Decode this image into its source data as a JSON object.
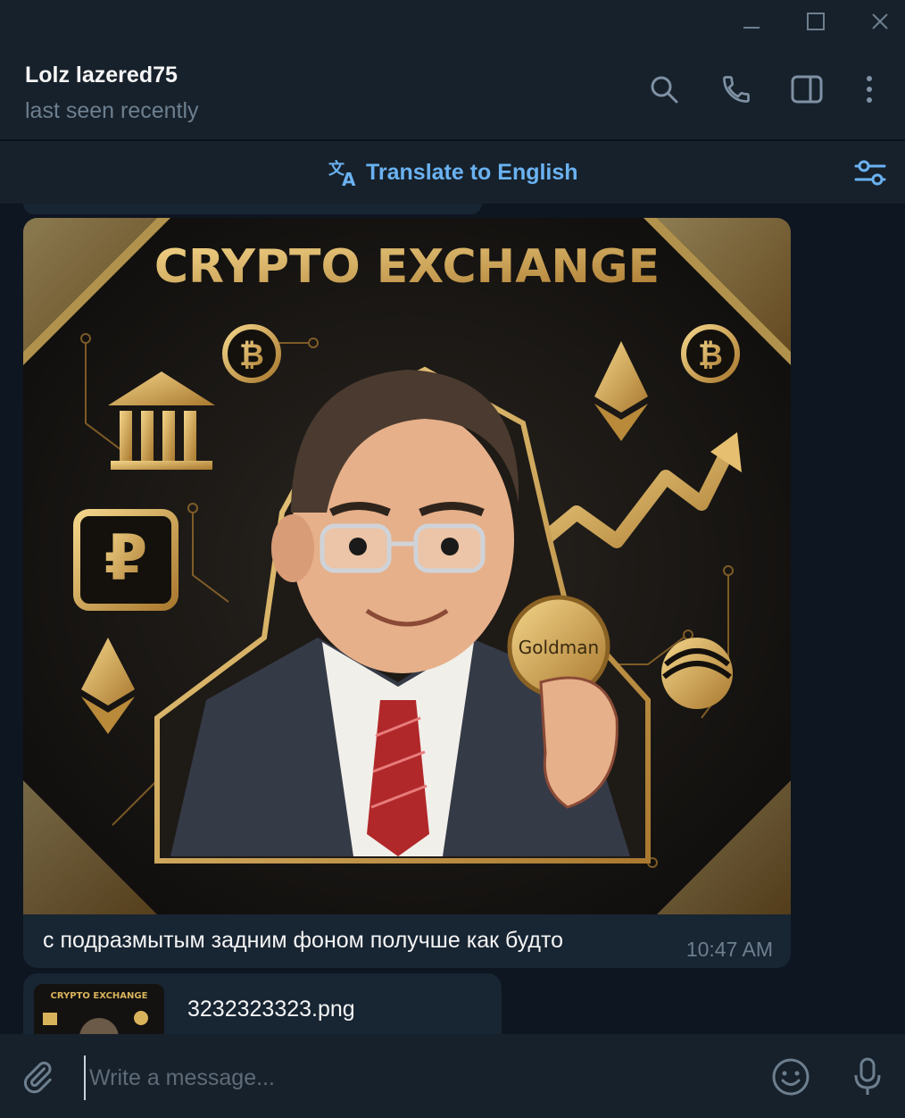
{
  "window": {
    "buttons": [
      "minimize-icon",
      "maximize-icon",
      "close-icon"
    ]
  },
  "header": {
    "name": "Lolz lazered75",
    "status": "last seen recently",
    "icons": [
      "search-icon",
      "phone-icon",
      "sidebar-icon",
      "more-vertical-icon"
    ]
  },
  "translate": {
    "label": "Translate to English",
    "icon": "translate-icon",
    "settings_icon": "filter-icon"
  },
  "message": {
    "image": {
      "title": "CRYPTO EXCHANGE",
      "coin_label": "Goldman",
      "currency_symbol": "₽",
      "bitcoin_symbol": "₿"
    },
    "caption": "с подразмытым задним фоном получше как будто",
    "time": "10:47 AM"
  },
  "file": {
    "name": "3232323323.png",
    "thumb_title": "CRYPTO EXCHANGE"
  },
  "composer": {
    "placeholder": "Write a message...",
    "icons": [
      "attach-icon",
      "emoji-icon",
      "microphone-icon"
    ]
  },
  "colors": {
    "background": "#0e1621",
    "panel": "#17212b",
    "bubble": "#182533",
    "accent": "#6ab2f2",
    "muted": "#6d7f8f",
    "gold": "#d9b35c"
  }
}
